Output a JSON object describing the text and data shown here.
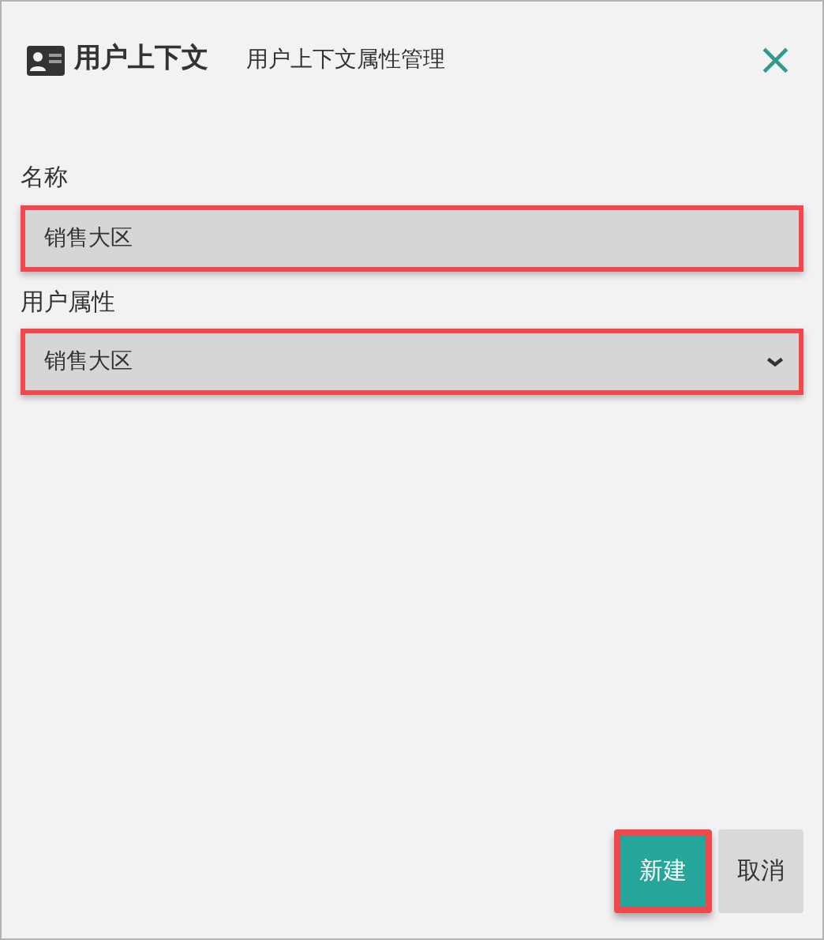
{
  "header": {
    "title": "用户上下文",
    "subtitle": "用户上下文属性管理",
    "close": "×"
  },
  "fields": [
    {
      "kind": "input",
      "label": "名称",
      "value": "销售大区",
      "highlighted": true
    },
    {
      "kind": "select",
      "label": "用户属性",
      "value": "销售大区",
      "highlighted": true
    }
  ],
  "buttons": [
    {
      "label": "新建",
      "kind": "primary",
      "highlighted": true
    },
    {
      "label": "取消",
      "kind": "secondary",
      "highlighted": false
    }
  ]
}
